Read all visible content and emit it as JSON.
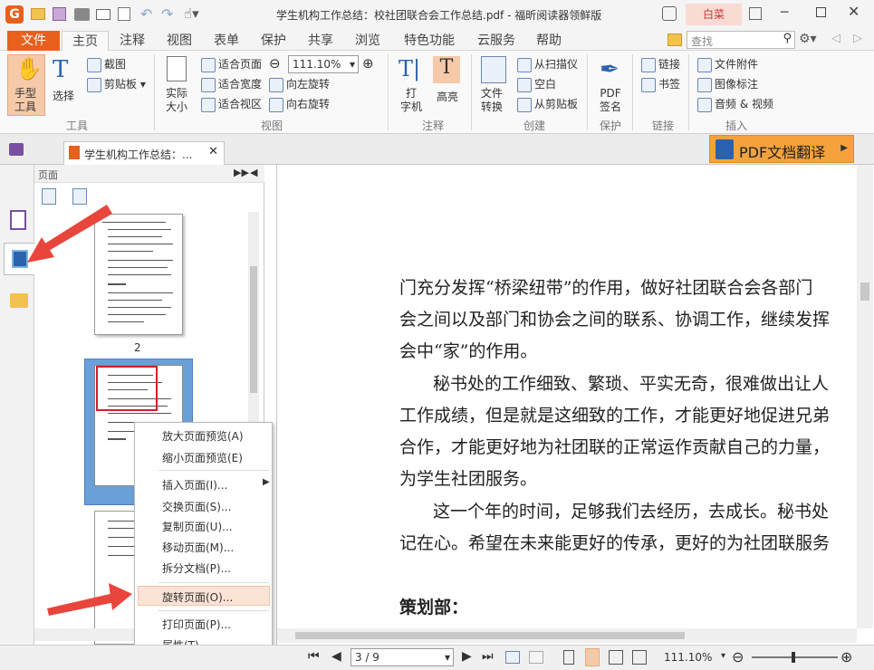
{
  "window": {
    "title": "学生机构工作总结：校社团联合会工作总结.pdf - 福昕阅读器领鲜版",
    "user": "白菜"
  },
  "ribbon_tabs": [
    "文件",
    "主页",
    "注释",
    "视图",
    "表单",
    "保护",
    "共享",
    "浏览",
    "特色功能",
    "云服务",
    "帮助"
  ],
  "search": {
    "placeholder": "查找"
  },
  "ribbon": {
    "tools": {
      "hand": "手型\n工具",
      "select": "选择",
      "snapshot": "截图",
      "clipboard": "剪贴板",
      "group": "工具"
    },
    "view": {
      "actual_size": "实际\n大小",
      "fit_page": "适合页面",
      "fit_width": "适合宽度",
      "fit_visible": "适合视区",
      "zoom": "111.10%",
      "rotate_left": "向左旋转",
      "rotate_right": "向右旋转",
      "group": "视图"
    },
    "comment": {
      "typewriter": "打\n字机",
      "highlight": "高亮",
      "group": "注释"
    },
    "create": {
      "file_convert": "文件\n转换",
      "from_scanner": "从扫描仪",
      "blank": "空白",
      "from_clipboard": "从剪贴板",
      "group": "创建"
    },
    "protect": {
      "pdf_sign": "PDF\n签名",
      "group": "保护"
    },
    "links": {
      "link": "链接",
      "bookmark": "书签",
      "group": "链接"
    },
    "insert": {
      "file_attachment": "文件附件",
      "image_annotation": "图像标注",
      "audio_video": "音频 & 视频",
      "group": "插入"
    }
  },
  "doc_tab": {
    "label": "学生机构工作总结：..."
  },
  "translate_button": "PDF文档翻译",
  "panel": {
    "title": "页面",
    "page2_label": "2"
  },
  "context_menu": [
    "放大页面预览(A)",
    "缩小页面预览(E)",
    "插入页面(I)...",
    "交换页面(S)...",
    "复制页面(U)...",
    "移动页面(M)...",
    "拆分文档(P)...",
    "旋转页面(O)...",
    "打印页面(P)...",
    "属性(T)..."
  ],
  "document_lines": [
    "门充分发挥“桥梁纽带”的作用，做好社团联合会各部门",
    "会之间以及部门和协会之间的联系、协调工作，继续发挥",
    "会中“家”的作用。",
    "秘书处的工作细致、繁琐、平实无奇，很难做出让人",
    "工作成绩，但是就是这细致的工作，才能更好地促进兄弟",
    "合作，才能更好地为社团联的正常运作贡献自己的力量，",
    "为学生社团服务。",
    "这一个年的时间，足够我们去经历，去成长。秘书处",
    "记在心。希望在未来能更好的传承，更好的为社团联服务",
    "策划部："
  ],
  "status": {
    "page": "3 / 9",
    "zoom": "111.10%"
  },
  "colors": {
    "accent": "#e8601c",
    "selected_thumb": "#6b9fd8",
    "arrow": "#e8453c"
  }
}
